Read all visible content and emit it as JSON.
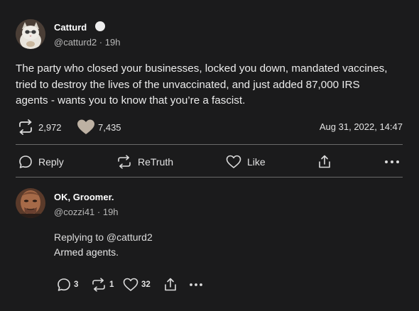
{
  "post": {
    "author_name": "Catturd",
    "handle": "@catturd2",
    "time": "19h",
    "body": "The party who closed your businesses, locked you down, mandated vaccines, tried to destroy the lives of the unvaccinated, and just added 87,000 IRS agents - wants you to know that you’re a fascist.",
    "retruth_count": "2,972",
    "like_count": "7,435",
    "timestamp": "Aug 31, 2022, 14:47",
    "avatar_icon": "cat-avatar",
    "verified_icon": "verified-badge-icon"
  },
  "actions": {
    "reply_label": "Reply",
    "retruth_label": "ReTruth",
    "like_label": "Like"
  },
  "reply": {
    "author_name": "OK, Groomer.",
    "handle": "@cozzi41",
    "time": "19h",
    "replying_to": "Replying to @catturd2",
    "body": "Armed agents.",
    "reply_count": "3",
    "retruth_count": "1",
    "like_count": "32",
    "avatar_icon": "portrait-avatar"
  },
  "colors": {
    "background": "#1b1b1c",
    "text": "#e6e6e6",
    "muted": "#b8b8b8",
    "divider": "#6a6a6a"
  }
}
